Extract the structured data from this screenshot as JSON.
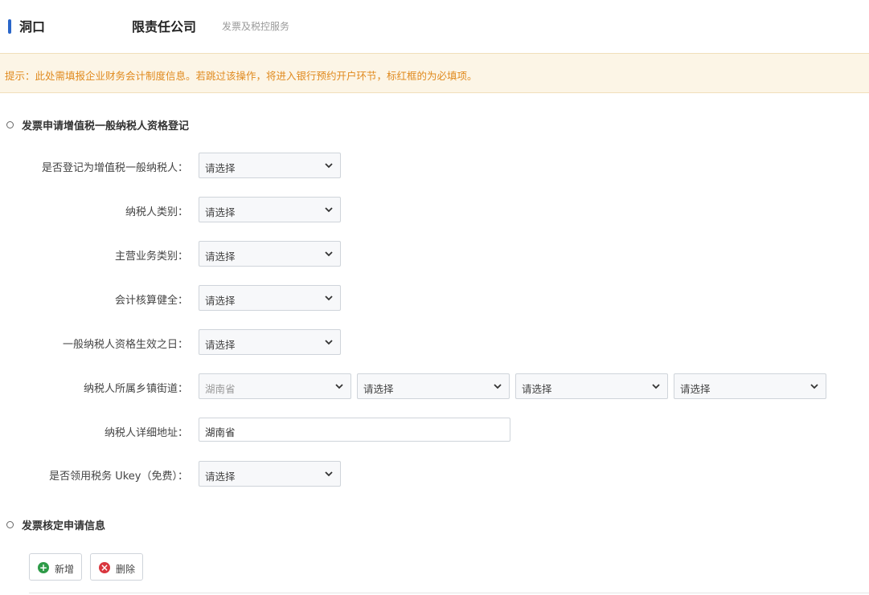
{
  "header": {
    "company_name": "洞口",
    "company_suffix": "限责任公司",
    "subtitle": "发票及税控服务"
  },
  "notice": {
    "text": "提示：此处需填报企业财务会计制度信息。若跳过该操作，将进入银行预约开户环节，标红框的为必填项。"
  },
  "section1": {
    "title": "发票申请增值税一般纳税人资格登记"
  },
  "form": {
    "general_taxpayer": {
      "label": "是否登记为增值税一般纳税人：",
      "value": "请选择"
    },
    "taxpayer_category": {
      "label": "纳税人类别：",
      "value": "请选择"
    },
    "business_category": {
      "label": "主营业务类别：",
      "value": "请选择"
    },
    "accounting_sound": {
      "label": "会计核算健全：",
      "value": "请选择"
    },
    "effective_date": {
      "label": "一般纳税人资格生效之日：",
      "value": "请选择"
    },
    "street": {
      "label": "纳税人所属乡镇街道：",
      "province": "湖南省",
      "city": "请选择",
      "county": "请选择",
      "town": "请选择"
    },
    "address": {
      "label": "纳税人详细地址：",
      "value": "湖南省"
    },
    "ukey": {
      "label": "是否领用税务 Ukey（免费）：",
      "value": "请选择"
    }
  },
  "section2": {
    "title": "发票核定申请信息"
  },
  "actions": {
    "add_label": "新增",
    "delete_label": "删除"
  },
  "colors": {
    "accent": "#2a66c9",
    "notice_text": "#e08a1e",
    "notice_bg": "#fcf5e6",
    "add_icon": "#2e9b48",
    "delete_icon": "#d9363e"
  }
}
